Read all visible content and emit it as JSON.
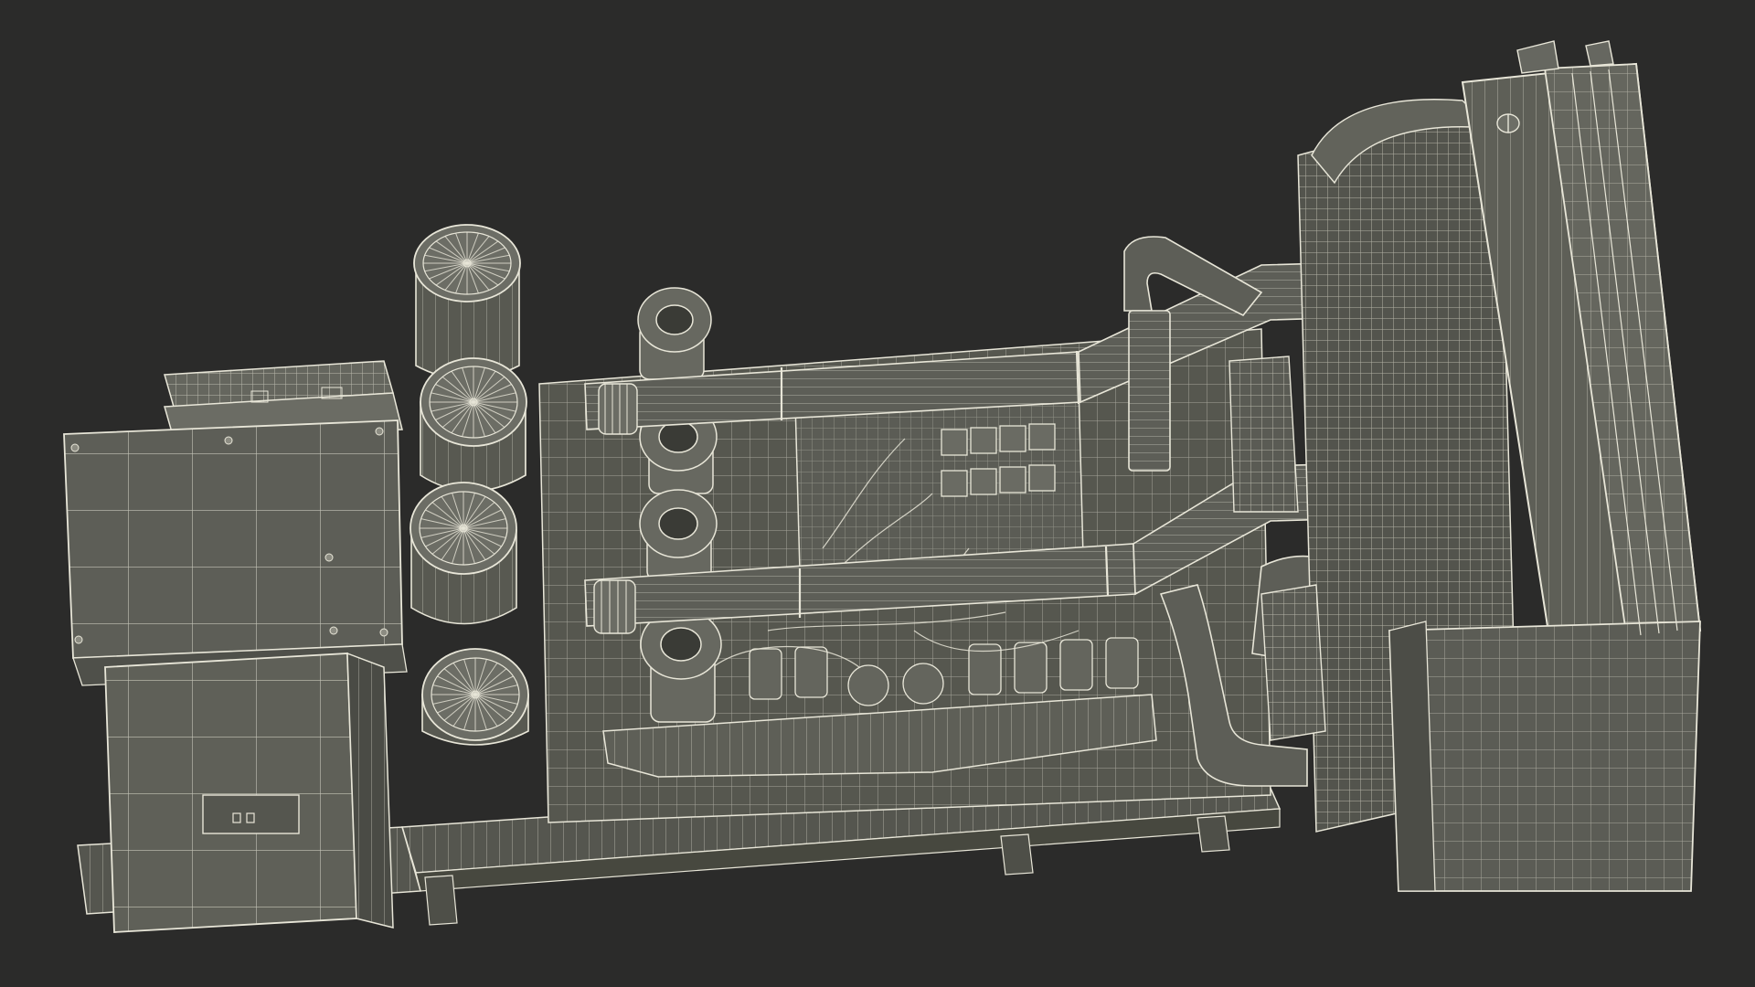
{
  "scene": {
    "background": "#2b2b2a",
    "body_fill": "#5a5b54",
    "body_fill_dark": "#4b4c46",
    "body_fill_light": "#6a6b63",
    "wire_color": "#e8e6d8",
    "wire_faint": "#b9b8ab"
  }
}
